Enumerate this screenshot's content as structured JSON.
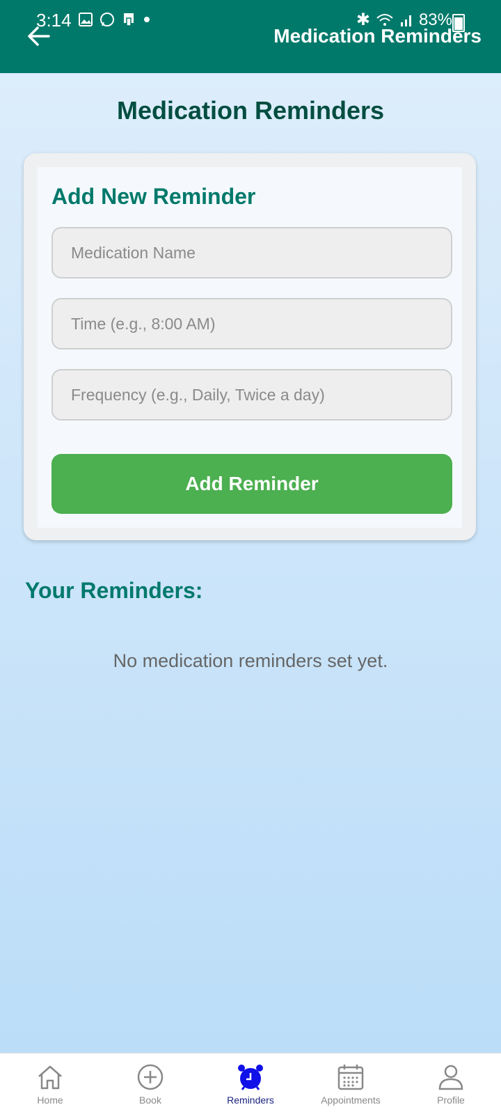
{
  "status_bar": {
    "time": "3:14",
    "battery": "83%"
  },
  "header": {
    "title": "Medication Reminders"
  },
  "page": {
    "title": "Medication Reminders"
  },
  "form": {
    "title": "Add New Reminder",
    "medication_placeholder": "Medication Name",
    "time_placeholder": "Time (e.g., 8:00 AM)",
    "frequency_placeholder": "Frequency (e.g., Daily, Twice a day)",
    "submit_label": "Add Reminder"
  },
  "reminders": {
    "title": "Your Reminders:",
    "empty_message": "No medication reminders set yet."
  },
  "bottom_nav": {
    "items": [
      {
        "label": "Home",
        "icon": "home-icon"
      },
      {
        "label": "Book",
        "icon": "plus-circle-icon"
      },
      {
        "label": "Reminders",
        "icon": "alarm-clock-icon",
        "active": true
      },
      {
        "label": "Appointments",
        "icon": "calendar-icon"
      },
      {
        "label": "Profile",
        "icon": "person-icon"
      }
    ]
  },
  "colors": {
    "header": "#00796b",
    "accent": "#4caf50",
    "active_nav": "#1a237e"
  }
}
